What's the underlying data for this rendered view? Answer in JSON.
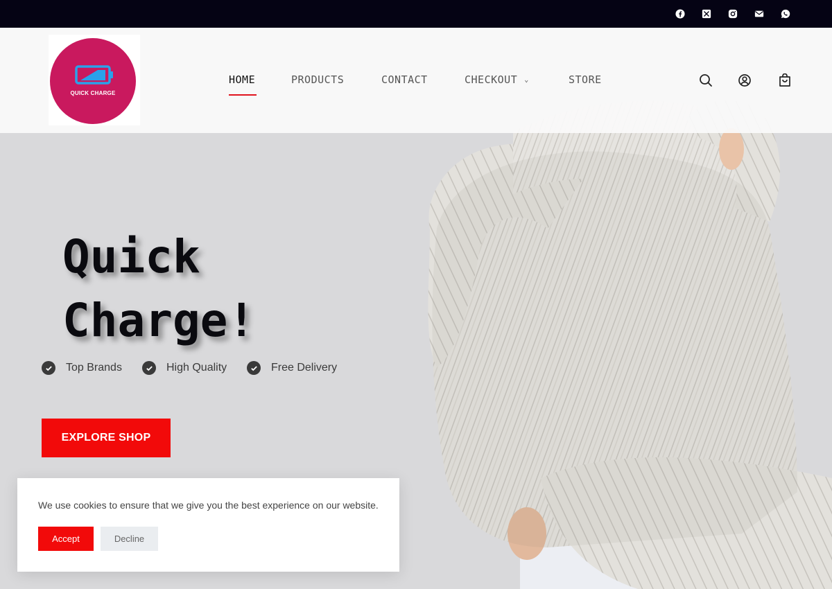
{
  "brand": {
    "logo_text": "QUICK CHARGE",
    "logo_color": "#c9195e",
    "battery_color": "#2aa1ea"
  },
  "topbar": {
    "background": "#050314",
    "social_icons": [
      "facebook-icon",
      "x-twitter-icon",
      "instagram-icon",
      "email-icon",
      "whatsapp-icon"
    ]
  },
  "nav": {
    "items": [
      {
        "label": "HOME",
        "active": true
      },
      {
        "label": "PRODUCTS"
      },
      {
        "label": "CONTACT"
      },
      {
        "label": "CHECKOUT",
        "has_dropdown": true
      },
      {
        "label": "STORE"
      }
    ],
    "icons": [
      "search-icon",
      "account-icon",
      "cart-icon"
    ],
    "accent": "#e0141e"
  },
  "hero": {
    "title_line1": "Quick",
    "title_line2": "Charge!",
    "features": [
      "Top Brands",
      "High Quality",
      "Free Delivery"
    ],
    "cta_label": "EXPLORE SHOP",
    "cta_color": "#f20a0a",
    "image": "sweater-photo"
  },
  "cookie": {
    "message": "We use cookies to ensure that we give you the best experience on our website.",
    "accept_label": "Accept",
    "decline_label": "Decline"
  }
}
